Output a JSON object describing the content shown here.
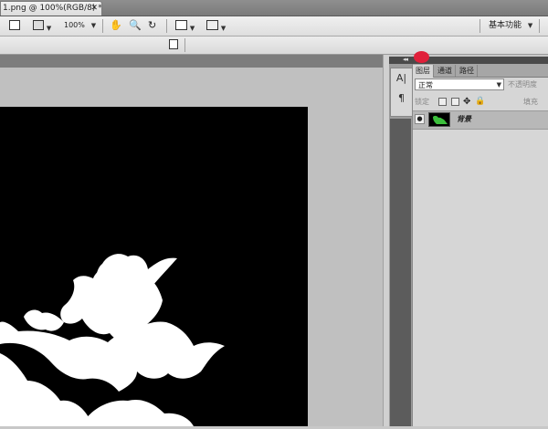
{
  "document_tab": {
    "title": "1.png @ 100%(RGB/8) *",
    "close": "✕"
  },
  "appbar": {
    "zoom_value": "100%",
    "workspace_label": "基本功能"
  },
  "panels": {
    "tabs": [
      "图层",
      "通道",
      "路径"
    ],
    "blend_mode": "正常",
    "opacity_label": "不透明度",
    "lock_label": "锁定",
    "fill_label": "填充",
    "layer_name": "背景"
  },
  "mini_panel": {
    "char_icon": "A|",
    "para_icon": "¶"
  },
  "colors": {
    "canvas": "#000000",
    "shape": "#ffffff",
    "marker": "#e0203a",
    "thumb_shape": "#3cbf3c"
  }
}
